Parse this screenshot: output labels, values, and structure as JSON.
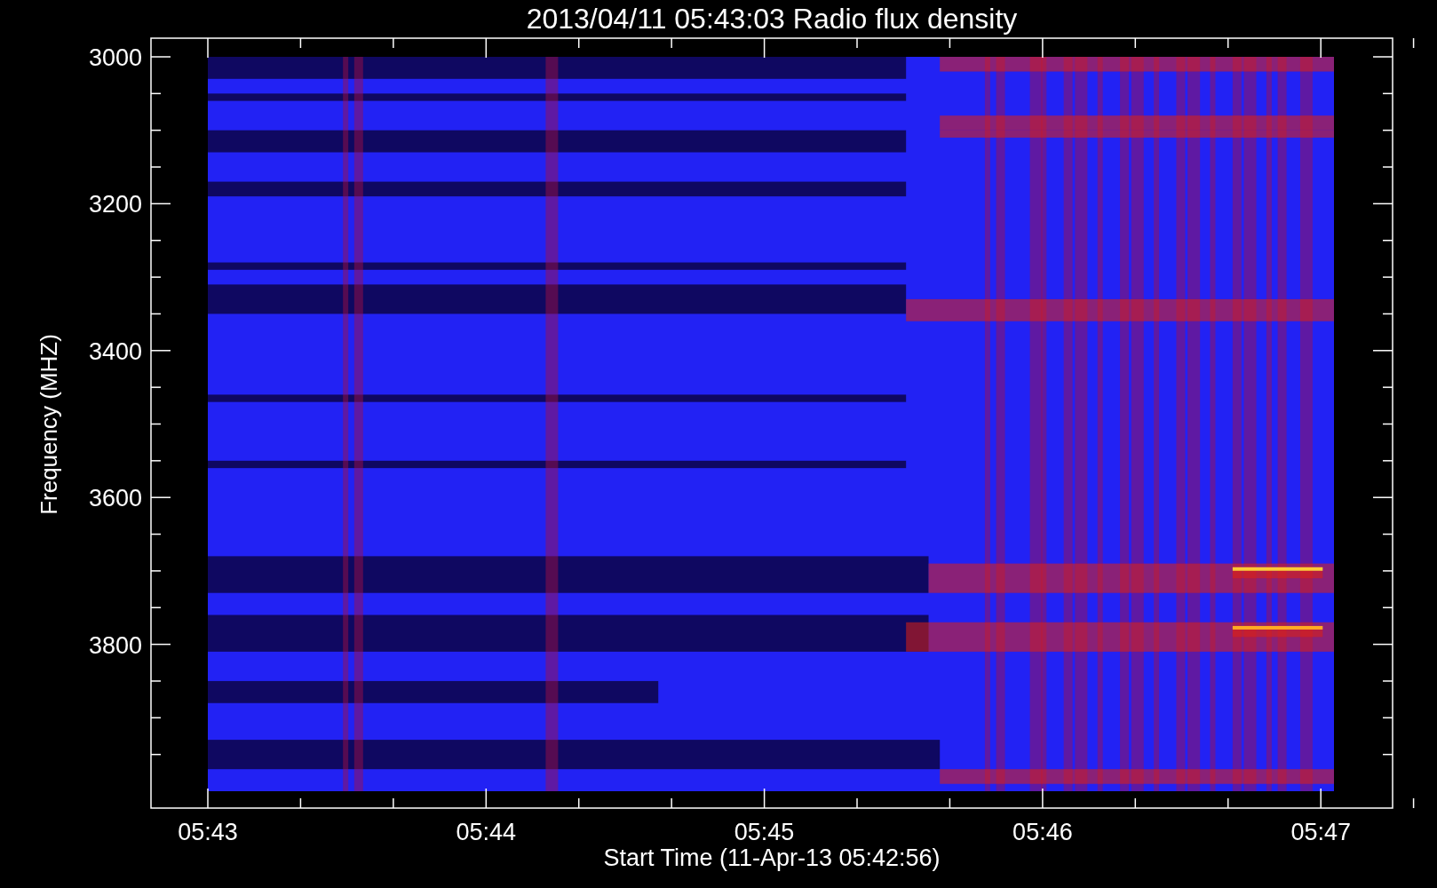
{
  "title": "2013/04/11 05:43:03 Radio flux density",
  "y_axis": {
    "label": "Frequency (MHZ)",
    "ticks": [
      "3000",
      "3200",
      "3400",
      "3600",
      "3800"
    ]
  },
  "x_axis": {
    "label": "Start Time (11-Apr-13 05:42:56)",
    "ticks": [
      "05:43",
      "05:44",
      "05:45",
      "05:46",
      "05:47"
    ]
  }
}
